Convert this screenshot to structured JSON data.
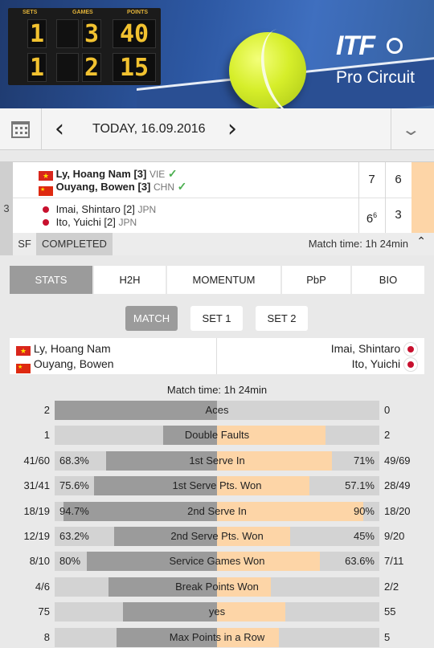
{
  "banner": {
    "scoreboard": {
      "labels": [
        "SETS",
        "GAMES",
        "POINTS"
      ],
      "row1": [
        "1",
        "3",
        "40"
      ],
      "row2": [
        "1",
        "2",
        "15"
      ]
    },
    "logo_main": "ITF",
    "logo_sub": "Pro Circuit"
  },
  "datebar": {
    "prev_icon": "chevron-left",
    "next_icon": "chevron-right",
    "date": "TODAY, 16.09.2016",
    "calendar_icon": "calendar",
    "dropdown_icon": "chevron-down"
  },
  "match": {
    "court_no": "3",
    "team1": {
      "p1": {
        "name": "Ly, Hoang Nam",
        "seed": "[3]",
        "country": "VIE"
      },
      "p2": {
        "name": "Ouyang, Bowen",
        "seed": "[3]",
        "country": "CHN"
      },
      "winner": true,
      "set1": "7",
      "set2": "6"
    },
    "team2": {
      "p1": {
        "name": "Imai, Shintaro",
        "seed": "[2]",
        "country": "JPN"
      },
      "p2": {
        "name": "Ito, Yuichi",
        "seed": "[2]",
        "country": "JPN"
      },
      "set1": "6",
      "set1_tb": "6",
      "set2": "3"
    },
    "round": "SF",
    "status": "COMPLETED",
    "match_time": "Match time: 1h 24min"
  },
  "tabs": [
    "STATS",
    "H2H",
    "MOMENTUM",
    "PbP",
    "BIO"
  ],
  "subtabs": [
    "MATCH",
    "SET 1",
    "SET 2"
  ],
  "players_header": {
    "left": [
      "Ly, Hoang Nam",
      "Ouyang, Bowen"
    ],
    "right": [
      "Imai, Shintaro",
      "Ito, Yuichi"
    ]
  },
  "stats_time": "Match time: 1h 24min",
  "colors": {
    "team1": "#9b9b9b",
    "team2": "#fdd5a7",
    "track": "#d3d3d3"
  },
  "stats": [
    {
      "label": "Aces",
      "left": "2",
      "right": "0",
      "left_pct": "",
      "right_pct": "",
      "lshare": 1.0,
      "rshare": 0.0
    },
    {
      "label": "Double Faults",
      "left": "1",
      "right": "2",
      "left_pct": "",
      "right_pct": "",
      "lshare": 0.33,
      "rshare": 0.67
    },
    {
      "label": "1st Serve In",
      "left": "41/60",
      "right": "49/69",
      "left_pct": "68.3%",
      "right_pct": "71%",
      "lshare": 0.683,
      "rshare": 0.71
    },
    {
      "label": "1st Serve Pts. Won",
      "left": "31/41",
      "right": "28/49",
      "left_pct": "75.6%",
      "right_pct": "57.1%",
      "lshare": 0.756,
      "rshare": 0.571
    },
    {
      "label": "2nd Serve In",
      "left": "18/19",
      "right": "18/20",
      "left_pct": "94.7%",
      "right_pct": "90%",
      "lshare": 0.947,
      "rshare": 0.9
    },
    {
      "label": "2nd Serve Pts. Won",
      "left": "12/19",
      "right": "9/20",
      "left_pct": "63.2%",
      "right_pct": "45%",
      "lshare": 0.632,
      "rshare": 0.45
    },
    {
      "label": "Service Games Won",
      "left": "8/10",
      "right": "7/11",
      "left_pct": "80%",
      "right_pct": "63.6%",
      "lshare": 0.8,
      "rshare": 0.636
    },
    {
      "label": "Break Points Won",
      "left": "4/6",
      "right": "2/2",
      "left_pct": "",
      "right_pct": "",
      "lshare": 0.67,
      "rshare": 0.33
    },
    {
      "label": "yes",
      "left": "75",
      "right": "55",
      "left_pct": "",
      "right_pct": "",
      "lshare": 0.58,
      "rshare": 0.42
    },
    {
      "label": "Max Points in a Row",
      "left": "8",
      "right": "5",
      "left_pct": "",
      "right_pct": "",
      "lshare": 0.62,
      "rshare": 0.38
    }
  ]
}
